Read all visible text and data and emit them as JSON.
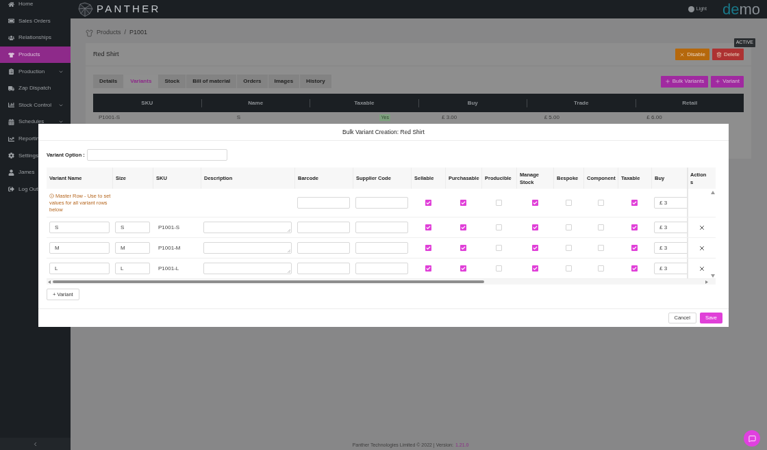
{
  "sidebar": {
    "items": [
      {
        "label": "Home",
        "selected": false,
        "expandable": false
      },
      {
        "label": "Sales Orders",
        "selected": false,
        "expandable": false
      },
      {
        "label": "Relationships",
        "selected": false,
        "expandable": false
      },
      {
        "label": "Products",
        "selected": true,
        "expandable": false
      },
      {
        "label": "Production",
        "selected": false,
        "expandable": true
      },
      {
        "label": "Zap Dispatch",
        "selected": false,
        "expandable": false
      },
      {
        "label": "Stock Control",
        "selected": false,
        "expandable": true
      },
      {
        "label": "Schedules",
        "selected": false,
        "expandable": true
      },
      {
        "label": "Reportin",
        "selected": false,
        "expandable": false
      },
      {
        "label": "Settings",
        "selected": false,
        "expandable": false
      },
      {
        "label": "James",
        "selected": false,
        "expandable": false
      },
      {
        "label": "Log Out",
        "selected": false,
        "expandable": false
      }
    ]
  },
  "header": {
    "brand": "PANTHER",
    "theme_toggle": {
      "label": "Light",
      "on": false
    },
    "env_logo": "demo"
  },
  "breadcrumb": [
    "Products",
    "/",
    "P1001"
  ],
  "product": {
    "name": "Red Shirt",
    "status": "ACTIVE",
    "actions": [
      {
        "label": "Disable",
        "kind": "disable"
      },
      {
        "label": "Delete",
        "kind": "delete"
      }
    ]
  },
  "tabs": [
    {
      "label": "Details",
      "selected": false
    },
    {
      "label": "Variants",
      "selected": true
    },
    {
      "label": "Stock",
      "selected": false
    },
    {
      "label": "Bill of material",
      "selected": false
    },
    {
      "label": "Orders",
      "selected": false
    },
    {
      "label": "Images",
      "selected": false
    },
    {
      "label": "History",
      "selected": false
    }
  ],
  "variant_actions": [
    "Bulk Variants",
    "Variant"
  ],
  "variants_table": {
    "columns": [
      "SKU",
      "Name",
      "Taxable",
      "Buy",
      "Trade",
      "Retail"
    ],
    "rows": [
      {
        "cells": [
          {
            "text": "P1001-S",
            "kind": "text"
          },
          {
            "text": "S",
            "kind": "text"
          },
          {
            "text": "Yes",
            "kind": "badge"
          },
          {
            "text": "£ 3.00",
            "kind": "text"
          },
          {
            "text": "£ 5.00",
            "kind": "text"
          },
          {
            "text": "£ 6.00",
            "kind": "text"
          }
        ]
      }
    ]
  },
  "modal": {
    "title": "Bulk Variant Creation: Red Shirt",
    "option_label": "Variant Option :",
    "columns": [
      "Variant Name",
      "Size",
      "SKU",
      "Description",
      "Barcode",
      "Supplier Code",
      "Sellable",
      "Purchasable",
      "Producible",
      "Manage Stock",
      "Bespoke",
      "Component",
      "Taxable",
      "Buy",
      "Actions"
    ],
    "master_row": {
      "note": "Master Row - Use to set values for all variant rows below",
      "flags": [
        {
          "checked": true
        },
        {
          "checked": true
        },
        {
          "checked": false
        },
        {
          "checked": true
        },
        {
          "checked": false
        },
        {
          "checked": false
        },
        {
          "checked": true
        }
      ],
      "buy": "£ 3"
    },
    "rows": [
      {
        "name": "S",
        "size": "S",
        "sku": "P1001-S",
        "flags": [
          {
            "checked": true
          },
          {
            "checked": true
          },
          {
            "checked": false
          },
          {
            "checked": true
          },
          {
            "checked": false
          },
          {
            "checked": false
          },
          {
            "checked": true
          }
        ],
        "buy": "£ 3"
      },
      {
        "name": "M",
        "size": "M",
        "sku": "P1001-M",
        "flags": [
          {
            "checked": true
          },
          {
            "checked": true
          },
          {
            "checked": false
          },
          {
            "checked": true
          },
          {
            "checked": false
          },
          {
            "checked": false
          },
          {
            "checked": true
          }
        ],
        "buy": "£ 3"
      },
      {
        "name": "L",
        "size": "L",
        "sku": "P1001-L",
        "flags": [
          {
            "checked": true
          },
          {
            "checked": true
          },
          {
            "checked": false
          },
          {
            "checked": true
          },
          {
            "checked": false
          },
          {
            "checked": false
          },
          {
            "checked": true
          }
        ],
        "buy": "£ 3"
      }
    ],
    "add_button": "+ Variant",
    "buttons": [
      {
        "label": "Cancel",
        "kind": "secondary"
      },
      {
        "label": "Save",
        "kind": "primary"
      }
    ]
  },
  "footer": {
    "text": "Panther Technologies Limited © 2022 | Version:",
    "version": "1.21.0"
  }
}
